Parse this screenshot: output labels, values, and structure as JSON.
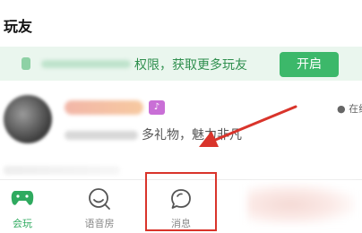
{
  "header": {
    "title": "玩友"
  },
  "banner": {
    "text": "权限，获取更多玩友",
    "button_label": "开启"
  },
  "user_row": {
    "badge_glyph": "♪",
    "description": "多礼物，魅力非凡",
    "status": "● 在线"
  },
  "tabbar": {
    "tabs": [
      {
        "label": "会玩",
        "icon": "gamepad-icon",
        "active": true
      },
      {
        "label": "语音房",
        "icon": "voice-room-icon",
        "active": false
      },
      {
        "label": "消息",
        "icon": "message-bubble-icon",
        "active": false
      }
    ]
  },
  "colors": {
    "accent": "#3cb86a",
    "annotation": "#d9342b",
    "banner_bg": "#eaf6ee"
  }
}
